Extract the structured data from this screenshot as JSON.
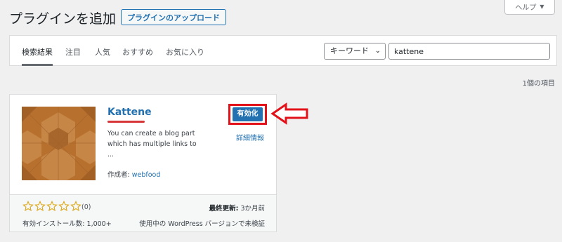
{
  "header": {
    "page_title": "プラグインを追加",
    "upload_button": "プラグインのアップロード",
    "help_tab": "ヘルプ",
    "help_arrow": "▼"
  },
  "filter_tabs": [
    "検索結果",
    "注目",
    "人気",
    "おすすめ",
    "お気に入り"
  ],
  "search": {
    "type_selected": "キーワード",
    "query": "kattene"
  },
  "result_count": "1個の項目",
  "plugin": {
    "name": "Kattene",
    "description": "You can create a blog part which has multiple links to",
    "description_ellipsis": "...",
    "author_label": "作成者:",
    "author": "webfood",
    "activate_label": "有効化",
    "more_info": "詳細情報",
    "rating_stars": 0,
    "rating_count": "(0)",
    "last_updated_label": "最終更新:",
    "last_updated_value": "3か月前",
    "active_installs": "有効インストール数: 1,000+",
    "compatibility": "使用中の WordPress バージョンで未検証"
  },
  "colors": {
    "accent": "#2271b1",
    "highlight_red": "#e2121a",
    "icon_brown": "#b8702e"
  }
}
